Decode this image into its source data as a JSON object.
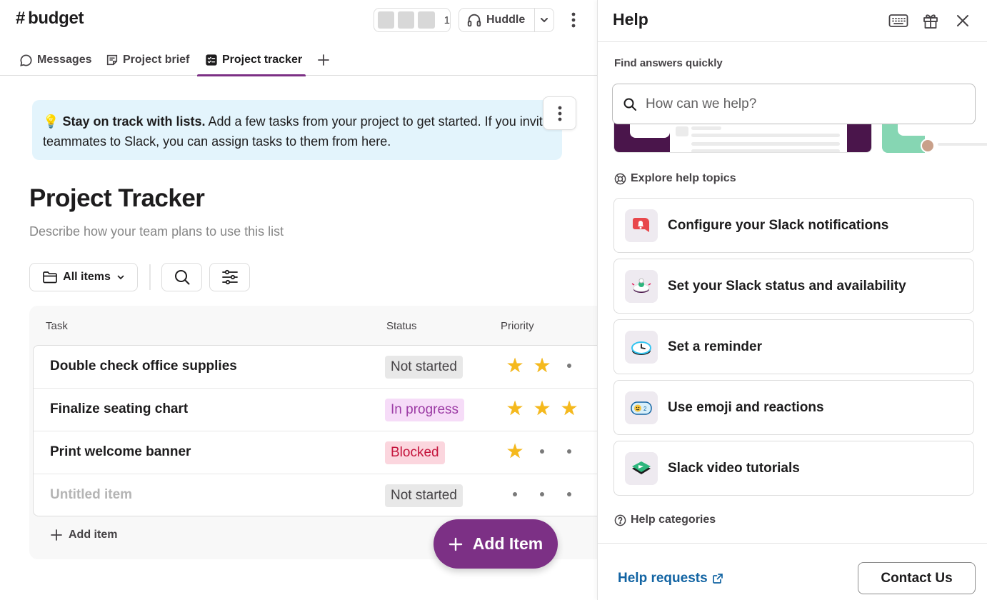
{
  "channel": {
    "hash": "#",
    "name": "budget",
    "member_count": "1",
    "huddle_label": "Huddle"
  },
  "tabs": [
    {
      "label": "Messages",
      "icon": "message-bubble-icon"
    },
    {
      "label": "Project brief",
      "icon": "canvas-doc-icon"
    },
    {
      "label": "Project tracker",
      "icon": "list-icon",
      "active": true
    }
  ],
  "banner": {
    "emoji": "💡",
    "bold": "Stay on track with lists.",
    "text": " Add a few tasks from your project to get started. If you invite teammates to Slack, you can assign tasks to them from here."
  },
  "list": {
    "title": "Project Tracker",
    "description": "Describe how your team plans to use this list",
    "view_label": "All items",
    "columns": [
      "Task",
      "Status",
      "Priority"
    ],
    "rows": [
      {
        "task": "Double check office supplies",
        "status": "Not started",
        "priority": 2
      },
      {
        "task": "Finalize seating chart",
        "status": "In progress",
        "priority": 3
      },
      {
        "task": "Print welcome banner",
        "status": "Blocked",
        "priority": 1
      },
      {
        "task": "Untitled item",
        "status": "Not started",
        "priority": 0,
        "placeholder": true
      }
    ],
    "priority_max": 3,
    "add_item_label": "Add item",
    "fab_label": "Add Item"
  },
  "status_colors": {
    "Not started": {
      "bg": "#e8e8e8",
      "fg": "#454245"
    },
    "In progress": {
      "bg": "#f6dcf8",
      "fg": "#9c3ba5"
    },
    "Blocked": {
      "bg": "#fbd6de",
      "fg": "#c4133b"
    }
  },
  "colors": {
    "accent": "#7c3085",
    "link": "#1264a3",
    "star": "#f5b91d"
  },
  "help": {
    "title": "Help",
    "find_label": "Find answers quickly",
    "search_placeholder": "How can we help?",
    "explore_label": "Explore help topics",
    "topics": [
      {
        "label": "Configure your Slack notifications",
        "icon": "bell-icon"
      },
      {
        "label": "Set your Slack status and availability",
        "icon": "status-icon"
      },
      {
        "label": "Set a reminder",
        "icon": "clock-icon"
      },
      {
        "label": "Use emoji and reactions",
        "icon": "emoji-reaction-icon"
      },
      {
        "label": "Slack video tutorials",
        "icon": "video-tutorial-icon"
      }
    ],
    "categories_label": "Help categories",
    "requests_label": "Help requests",
    "contact_label": "Contact Us"
  }
}
